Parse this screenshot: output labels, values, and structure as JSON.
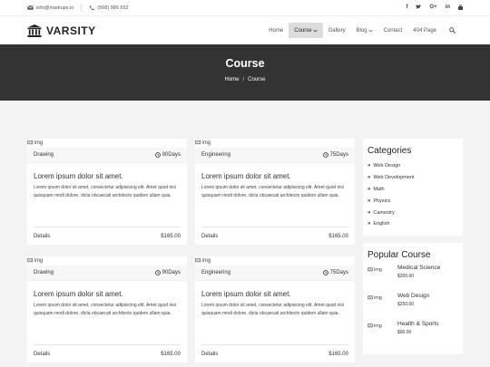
{
  "topbar": {
    "email": "info@markups.io",
    "phone": "(568) 986 652",
    "social": [
      "facebook-icon",
      "twitter-icon",
      "google-plus-icon",
      "linkedin-icon",
      "youtube-icon"
    ]
  },
  "brand": {
    "name": "VARSITY"
  },
  "nav": {
    "items": [
      {
        "label": "Home"
      },
      {
        "label": "Course"
      },
      {
        "label": "Gallery"
      },
      {
        "label": "Blog"
      },
      {
        "label": "Contact"
      },
      {
        "label": "404 Page"
      }
    ]
  },
  "hero": {
    "title": "Course",
    "crumb_home": "Home",
    "crumb_current": "Course"
  },
  "courses": [
    {
      "img_alt": "img",
      "category": "Drawing",
      "duration": "90Days",
      "title": "Lorem ipsum dolor sit amet.",
      "desc": "Lorem ipsum dolor sit amet, consectetur adipisicing elit. Amet quod nisi quisquam modi dolore, dicta obcaecati architecto quidem ullam quia.",
      "details": "Details",
      "price": "$165.00"
    },
    {
      "img_alt": "img",
      "category": "Engineering",
      "duration": "75Days",
      "title": "Lorem ipsum dolor sit amet.",
      "desc": "Lorem ipsum dolor sit amet, consectetur adipisicing elit. Amet quod nisi quisquam modi dolore, dicta obcaecati architecto quidem ullam quia.",
      "details": "Details",
      "price": "$165.00"
    },
    {
      "img_alt": "img",
      "category": "Drawing",
      "duration": "90Days",
      "title": "Lorem ipsum dolor sit amet.",
      "desc": "Lorem ipsum dolor sit amet, consectetur adipisicing elit. Amet quod nisi quisquam modi dolore, dicta obcaecati architecto quidem ullam quia.",
      "details": "Details",
      "price": "$165.00"
    },
    {
      "img_alt": "img",
      "category": "Engineering",
      "duration": "75Days",
      "title": "Lorem ipsum dolor sit amet.",
      "desc": "Lorem ipsum dolor sit amet, consectetur adipisicing elit. Amet quod nisi quisquam modi dolore, dicta obcaecati architecto quidem ullam quia.",
      "details": "Details",
      "price": "$165.00"
    }
  ],
  "sidebar": {
    "categories_title": "Categories",
    "categories": [
      "Web Design",
      "Web Development",
      "Math",
      "Physics",
      "Camestry",
      "English"
    ],
    "popular_title": "Popular Course",
    "popular": [
      {
        "img_alt": "img",
        "name": "Medical Science",
        "price": "$200.00"
      },
      {
        "img_alt": "img",
        "name": "Web Design",
        "price": "$250.00"
      },
      {
        "img_alt": "img",
        "name": "Health & Sports",
        "price": "$90.00"
      }
    ]
  },
  "colors": {
    "hero_bg": "#333333",
    "page_bg": "#f3f3f3",
    "active_nav_bg": "#dddddd"
  }
}
